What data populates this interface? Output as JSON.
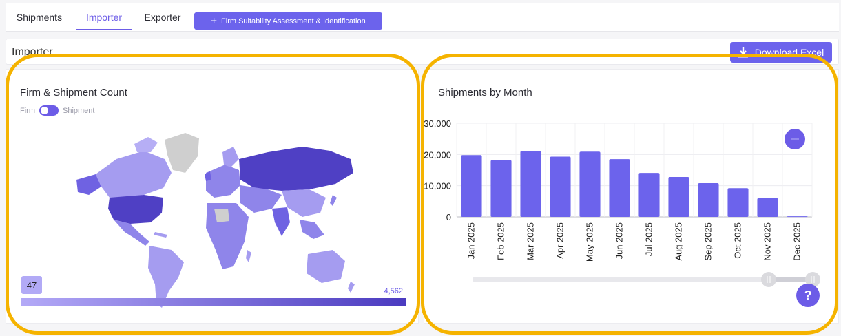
{
  "tabs": [
    {
      "label": "Shipments"
    },
    {
      "label": "Importer"
    },
    {
      "label": "Exporter"
    }
  ],
  "assess_button": {
    "label": "Firm Suitability Assessment & Identification",
    "icon": "plus-icon"
  },
  "subheader": {
    "title": "Importer"
  },
  "download_button": {
    "label": "Download Excel",
    "icon": "download-icon"
  },
  "map_card": {
    "title": "Firm & Shipment Count",
    "toggle_left": "Firm",
    "toggle_right": "Shipment",
    "scale_min": "47",
    "scale_max": "4,562"
  },
  "chart_card": {
    "title": "Shipments by Month"
  },
  "help": {
    "label": "?"
  },
  "colors": {
    "accent": "#6c5ce7",
    "highlight_ring": "#f5b300",
    "bar": "#6c63ec"
  },
  "chart_data": {
    "type": "bar",
    "title": "Shipments by Month",
    "categories": [
      "Jan 2025",
      "Feb 2025",
      "Mar 2025",
      "Apr 2025",
      "May 2025",
      "Jun 2025",
      "Jul 2025",
      "Aug 2025",
      "Sep 2025",
      "Oct 2025",
      "Nov 2025",
      "Dec 2025"
    ],
    "values": [
      19800,
      18200,
      21100,
      19300,
      20900,
      18500,
      14100,
      12800,
      10800,
      9200,
      6000,
      200
    ],
    "yticks": [
      "0",
      "10,000",
      "20,000",
      "30,000"
    ],
    "ylim": [
      0,
      30000
    ],
    "grid": true
  }
}
